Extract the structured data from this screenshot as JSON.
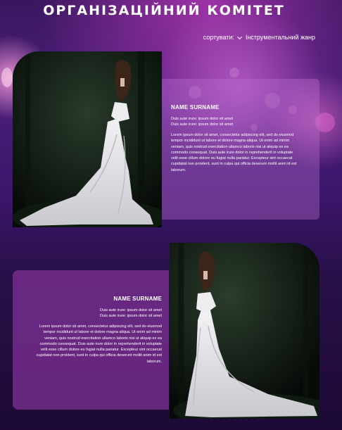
{
  "page": {
    "title": "ОРГАНІЗАЦІЙНИЙ КОМІТЕТ"
  },
  "sort": {
    "label": "сортувати:",
    "selected": "Інструментальний жанр"
  },
  "icons": {
    "sort_dropdown": "chevron-down-icon"
  },
  "colors": {
    "background_top": "#4a1f78",
    "background_bottom": "#1c0a35",
    "card_light": "#b66ed2",
    "card_dark": "#732d8c",
    "text": "#ffffff"
  },
  "members": [
    {
      "name": "NAME SURNAME",
      "line1": "Duis aute irure:  ipsum dolor sit amet",
      "line2": "Duis aute irure:  ipsum dolor sit amet",
      "bio": "Lorem ipsum dolor sit amet, consectetur adipiscing elit, sed do eiusmod tempor incididunt ut labore et dolore magna aliqua. Ut enim ad minim veniam, quis nostrud exercitation ullamco laboris nisi ut aliquip ex ea commodo consequat. Duis aute irure dolor in reprehenderit in voluptate velit esse cillum dolore eu fugiat nulla pariatur. Excepteur sint occaecat cupidatat non proident, sunt in culpa qui officia deserunt mollit anim id est laborum."
    },
    {
      "name": "NAME SURNAME",
      "line1": "Duis aute irure:  ipsum dolor sit amet",
      "line2": "Duis aute irure:  ipsum dolor sit amet",
      "bio": "Lorem ipsum dolor sit amet, consectetur adipiscing elit, sed do eiusmod tempor incididunt ut labore et dolore magna aliqua. Ut enim ad minim veniam, quis nostrud exercitation ullamco laboris nisi ut aliquip ex ea commodo consequat. Duis aute irure dolor in reprehenderit in voluptate velit esse cillum dolore eu fugiat nulla pariatur. Excepteur sint occaecat cupidatat non proident, sunt in culpa qui officia deserunt mollit anim id est laborum."
    }
  ]
}
